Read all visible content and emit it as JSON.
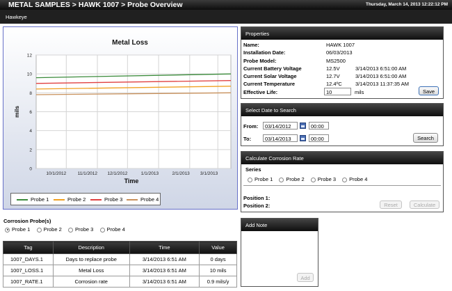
{
  "header": {
    "breadcrumb": "METAL SAMPLES >  HAWK 1007 > Probe Overview",
    "datetime": "Thursday, March 14, 2013 12:22:12 PM",
    "subtitle": "Hawkeye"
  },
  "chart_data": {
    "type": "line",
    "title": "Metal Loss",
    "xlabel": "Time",
    "ylabel": "mils",
    "ylim": [
      0,
      12
    ],
    "yticks": [
      0,
      2,
      4,
      6,
      8,
      10,
      12
    ],
    "xticks": [
      "10/1/2012",
      "11/1/2012",
      "12/1/2012",
      "1/1/2013",
      "2/1/2013",
      "3/1/2013"
    ],
    "x": [
      "9/1/2012",
      "3/14/2013"
    ],
    "grid": true,
    "legend_position": "bottom",
    "series": [
      {
        "name": "Probe 1",
        "color": "#3a8a3a",
        "values": [
          9.6,
          10.0
        ]
      },
      {
        "name": "Probe 2",
        "color": "#f0a020",
        "values": [
          8.4,
          8.7
        ]
      },
      {
        "name": "Probe 3",
        "color": "#e04040",
        "values": [
          9.0,
          9.3
        ]
      },
      {
        "name": "Probe 4",
        "color": "#c8905a",
        "values": [
          7.8,
          8.0
        ]
      }
    ]
  },
  "properties": {
    "title": "Properties",
    "name_label": "Name:",
    "name": "HAWK 1007",
    "install_label": "Installation Date:",
    "install": "06/03/2013",
    "model_label": "Probe Model:",
    "model": "MS2500",
    "battery_label": "Current Battery Voltage",
    "battery": "12.5V",
    "battery_time": "3/14/2013 6:51:00 AM",
    "solar_label": "Current Solar Voltage",
    "solar": "12.7V",
    "solar_time": "3/14/2013 6:51:00 AM",
    "temp_label": "Current Temperature",
    "temp": "12.4ºC",
    "temp_time": "3/14/2013 11:37:35 AM",
    "life_label": "Effective Life:",
    "life": "10",
    "life_unit": "mils",
    "save": "Save"
  },
  "date_search": {
    "title": "Select Date to Search",
    "from_label": "From:",
    "from_date": "03/14/2012",
    "from_time": "00:00",
    "to_label": "To:",
    "to_date": "03/14/2013",
    "to_time": "00:00",
    "search": "Search"
  },
  "corrosion_rate": {
    "title": "Calculate Corrosion Rate",
    "series_label": "Series",
    "options": [
      "Probe 1",
      "Probe 2",
      "Probe 3",
      "Probe 4"
    ],
    "pos1": "Position 1:",
    "pos2": "Position 2:",
    "reset": "Reset",
    "calculate": "Calculate"
  },
  "add_note": {
    "title": "Add Note",
    "add": "Add"
  },
  "corrosion_probes": {
    "title": "Corrosion Probe(s)",
    "options": [
      "Probe 1",
      "Probe 2",
      "Probe 3",
      "Probe 4"
    ],
    "selected": "Probe 1"
  },
  "table": {
    "headers": [
      "Tag",
      "Description",
      "Time",
      "Value"
    ],
    "rows": [
      [
        "1007_DAYS.1",
        "Days to replace probe",
        "3/14/2013 6:51 AM",
        "0 days"
      ],
      [
        "1007_LOSS.1",
        "Metal Loss",
        "3/14/2013 6:51 AM",
        "10 mils"
      ],
      [
        "1007_RATE.1",
        "Corrosion rate",
        "3/14/2013 6:51 AM",
        "0.9 mils/y"
      ]
    ]
  }
}
